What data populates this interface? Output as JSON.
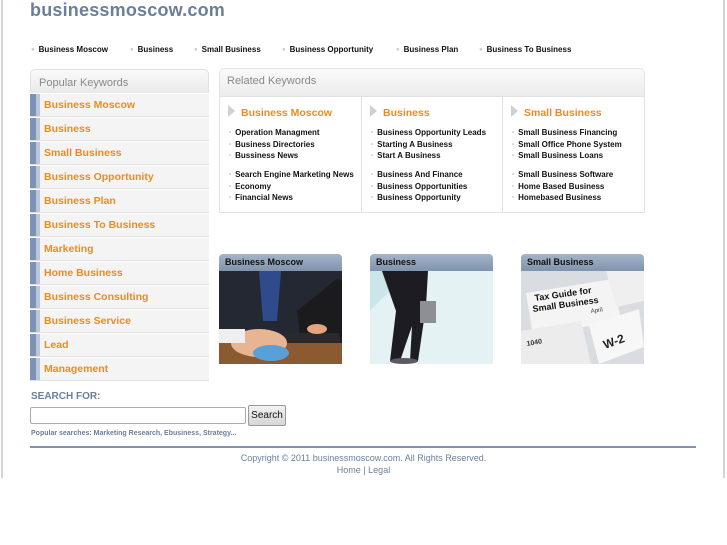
{
  "site": {
    "title": "businessmoscow.com"
  },
  "topnav": [
    {
      "label": "Business Moscow"
    },
    {
      "label": "Business"
    },
    {
      "label": "Small Business"
    },
    {
      "label": "Business Opportunity"
    },
    {
      "label": "Business Plan"
    },
    {
      "label": "Business To Business"
    }
  ],
  "popular": {
    "header": "Popular Keywords",
    "items": [
      {
        "label": "Business Moscow"
      },
      {
        "label": "Business"
      },
      {
        "label": "Small Business"
      },
      {
        "label": "Business Opportunity"
      },
      {
        "label": "Business Plan"
      },
      {
        "label": "Business To Business"
      },
      {
        "label": "Marketing"
      },
      {
        "label": "Home Business"
      },
      {
        "label": "Business Consulting"
      },
      {
        "label": "Business Service"
      },
      {
        "label": "Lead"
      },
      {
        "label": "Management"
      }
    ]
  },
  "related": {
    "header": "Related Keywords",
    "columns": [
      {
        "title": "Business Moscow",
        "group1": [
          "Operation Managment",
          "Business Directories",
          "Bussiness News"
        ],
        "group2": [
          "Search Engine Marketing News",
          "Economy",
          "Financial News"
        ]
      },
      {
        "title": "Business",
        "group1": [
          "Business Opportunity Leads",
          "Starting A Business",
          "Start A Business"
        ],
        "group2": [
          "Business And Finance",
          "Business Opportunities",
          "Business Opportunity"
        ]
      },
      {
        "title": "Small Business",
        "group1": [
          "Small Business Financing",
          "Small Office Phone System",
          "Small Business Loans"
        ],
        "group2": [
          "Small Business Software",
          "Home Based Business",
          "Homebased Business"
        ]
      }
    ]
  },
  "tiles": [
    {
      "caption": "Business Moscow",
      "image": "businessman-using-mouse-and-laptop"
    },
    {
      "caption": "Business",
      "image": "businessman-with-briefcase"
    },
    {
      "caption": "Small Business",
      "image": "tax-guide-for-small-business-forms",
      "image_text": [
        "Tax Guide for",
        "Small Business",
        "April",
        "W-2",
        "1040"
      ]
    }
  ],
  "search": {
    "label": "SEARCH FOR:",
    "value": "",
    "placeholder": "",
    "button": "Search",
    "popular": "Popular searches: Marketing Research, Ebusiness, Strategy..."
  },
  "footer": {
    "copyright": "Copyright © 2011 businessmoscow.com. All Rights Reserved.",
    "links": [
      "Home",
      "Legal"
    ],
    "separator": "|"
  },
  "colors": {
    "keyword_orange": "#f08a1c",
    "brand_slate": "#6b7f99",
    "accent_bar": "#7d92b4"
  }
}
